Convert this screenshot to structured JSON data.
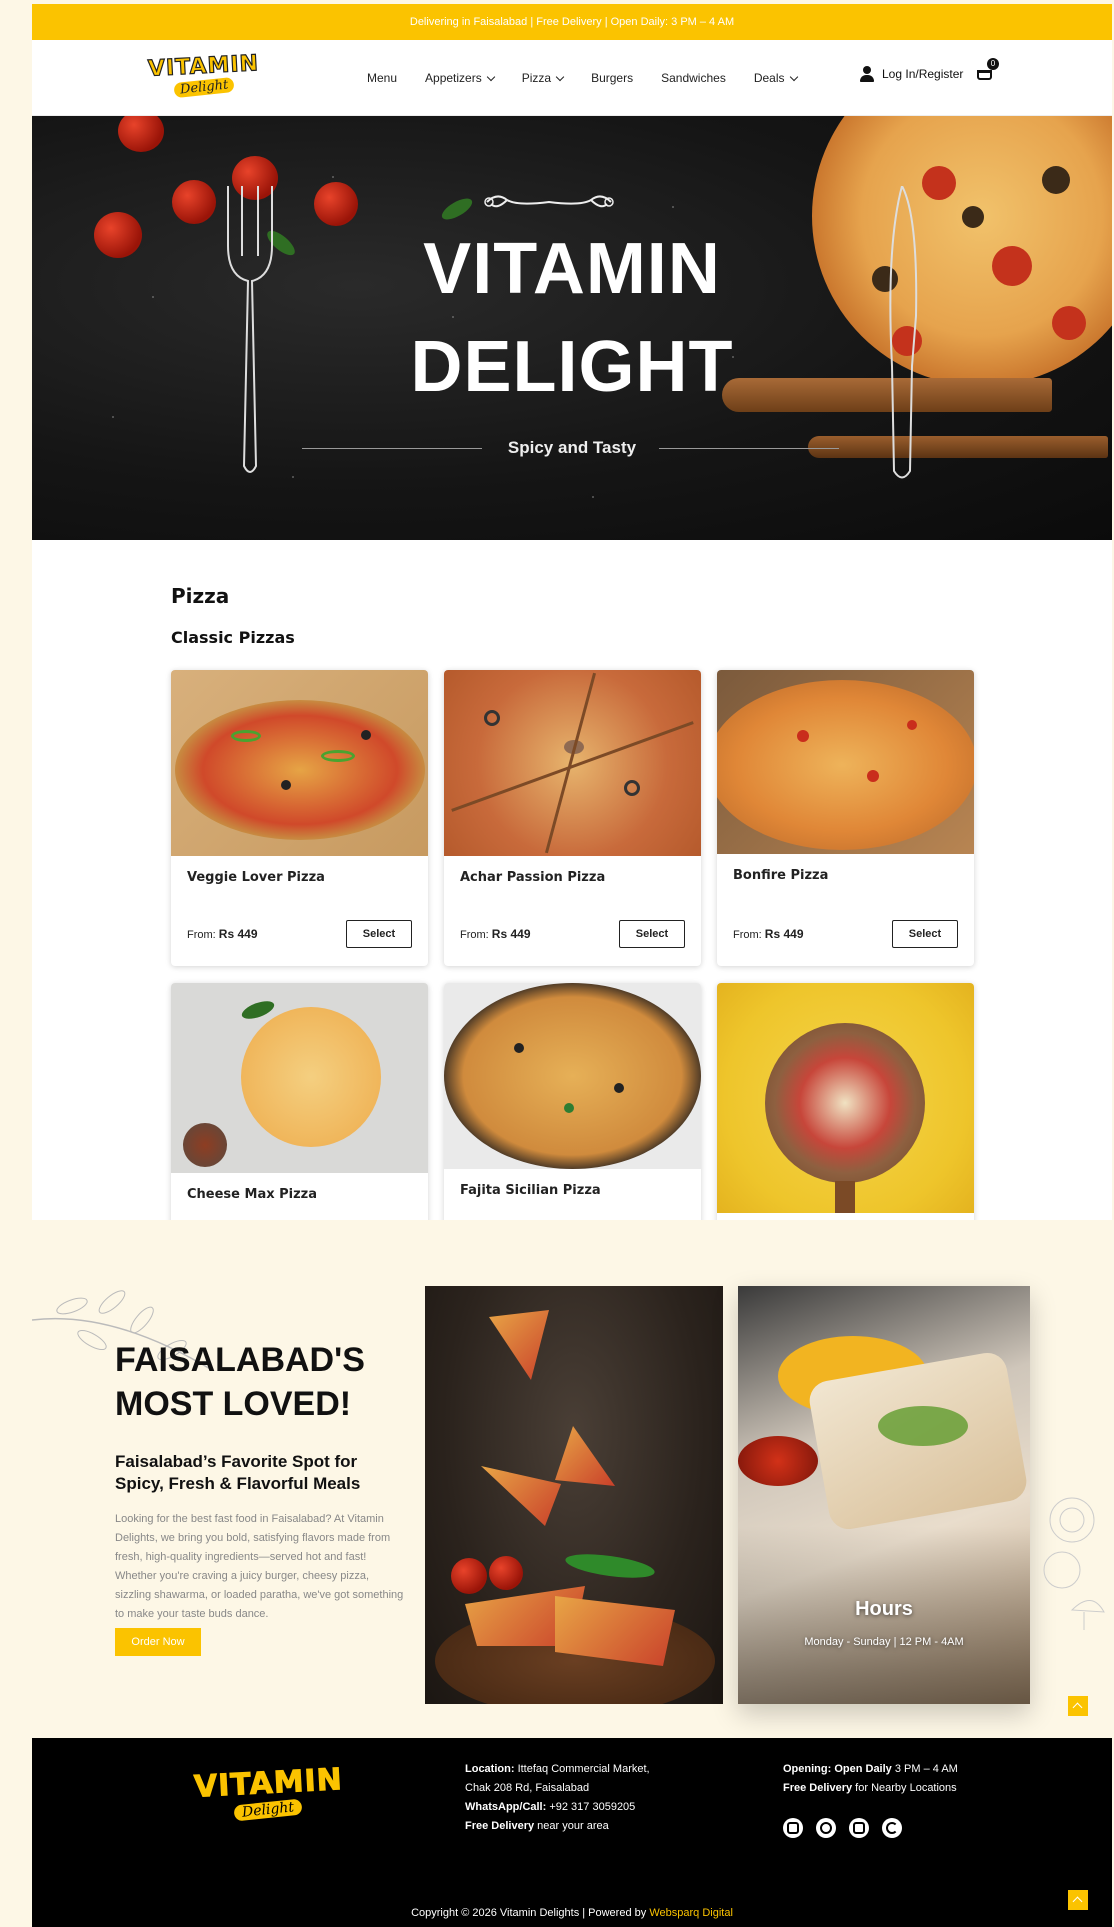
{
  "topbar": {
    "text": "Delivering in Faisalabad | Free Delivery | Open Daily: 3 PM – 4 AM"
  },
  "brand": {
    "logo_text": "VITAMIN",
    "logo_script": "Delight",
    "accent": "#fbc300"
  },
  "nav": {
    "items": [
      {
        "label": "Menu",
        "dropdown": false
      },
      {
        "label": "Appetizers",
        "dropdown": true
      },
      {
        "label": "Pizza",
        "dropdown": true
      },
      {
        "label": "Burgers",
        "dropdown": false
      },
      {
        "label": "Sandwiches",
        "dropdown": false
      },
      {
        "label": "Deals",
        "dropdown": true
      }
    ],
    "login_label": "Log In/Register",
    "cart_count": "0",
    "icons": [
      "user-icon",
      "cart-icon"
    ]
  },
  "hero": {
    "title_line1": "VITAMIN",
    "title_line2": "DELIGHT",
    "subtitle": "Spicy and Tasty"
  },
  "menu": {
    "heading": "Pizza",
    "subheading": "Classic Pizzas",
    "price_prefix": "From:",
    "select_label": "Select",
    "items": [
      {
        "name": "Veggie Lover Pizza",
        "price": "Rs 449"
      },
      {
        "name": "Achar Passion Pizza",
        "price": "Rs 449"
      },
      {
        "name": "Bonfire Pizza",
        "price": "Rs 449"
      },
      {
        "name": "Cheese Max Pizza"
      },
      {
        "name": "Fajita Sicilian Pizza"
      },
      {
        "name": ""
      }
    ]
  },
  "about": {
    "heading_line1": "FAISALABAD'S",
    "heading_line2": "MOST LOVED!",
    "subheading": "Faisalabad’s Favorite Spot for Spicy, Fresh & Flavorful Meals",
    "body": "Looking for the best fast food in Faisalabad? At Vitamin Delights, we bring you bold, satisfying flavors made from fresh, high-quality ingredients—served hot and fast! Whether you're craving a juicy burger, cheesy pizza, sizzling shawarma, or loaded paratha, we've got something to make your taste buds dance.",
    "cta": "Order Now",
    "hours_title": "Hours",
    "hours_text": "Monday - Sunday | 12 PM - 4AM"
  },
  "footer": {
    "location_label": "Location:",
    "location_line1": "Ittefaq Commercial Market,",
    "location_line2": "Chak 208 Rd, Faisalabad",
    "whatsapp_label": "WhatsApp/Call:",
    "whatsapp": "+92 317 3059205",
    "delivery_label": "Free Delivery",
    "delivery_text": "near your area",
    "opening_label": "Opening: Open Daily",
    "opening_text": "3 PM – 4 AM",
    "free_delivery_label": "Free Delivery",
    "free_delivery_text": "for Nearby Locations",
    "socials": [
      "instagram-icon",
      "whatsapp-icon",
      "facebook-icon",
      "google-icon"
    ],
    "copyright": "Copyright © 2026 Vitamin Delights | Powered by",
    "powered_by": "Websparq Digital"
  }
}
